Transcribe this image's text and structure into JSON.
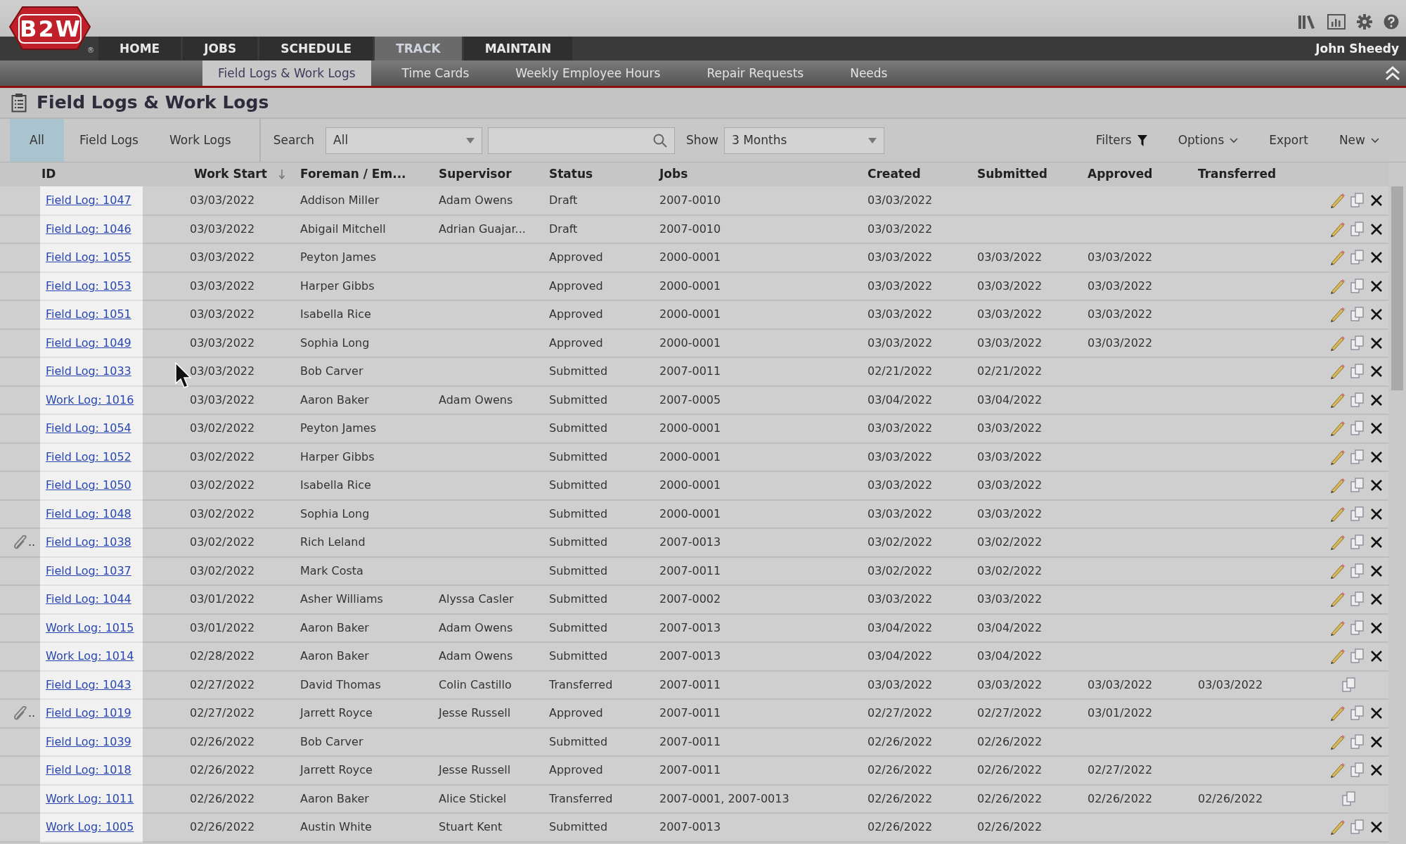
{
  "logo": {
    "text": "B2W",
    "mark": "®"
  },
  "user": "John Sheedy",
  "nav_tabs": [
    {
      "label": "HOME",
      "selected": false
    },
    {
      "label": "JOBS",
      "selected": false
    },
    {
      "label": "SCHEDULE",
      "selected": false
    },
    {
      "label": "TRACK",
      "selected": true
    },
    {
      "label": "MAINTAIN",
      "selected": false
    }
  ],
  "sub_tabs": [
    {
      "label": "Field Logs & Work Logs",
      "selected": true
    },
    {
      "label": "Time Cards",
      "selected": false
    },
    {
      "label": "Weekly Employee Hours",
      "selected": false
    },
    {
      "label": "Repair Requests",
      "selected": false
    },
    {
      "label": "Needs",
      "selected": false
    }
  ],
  "page_title": "Field Logs & Work Logs",
  "filter_tabs": [
    {
      "label": "All",
      "selected": true
    },
    {
      "label": "Field Logs",
      "selected": false
    },
    {
      "label": "Work Logs",
      "selected": false
    }
  ],
  "search": {
    "label": "Search",
    "scope": "All"
  },
  "show": {
    "label": "Show",
    "value": "3 Months"
  },
  "toolbar_actions": [
    {
      "label": "Filters",
      "kind": "filter"
    },
    {
      "label": "Options",
      "kind": "menu"
    },
    {
      "label": "Export",
      "kind": "plain"
    },
    {
      "label": "New",
      "kind": "menu"
    }
  ],
  "table": {
    "columns": [
      {
        "label": "ID",
        "sorted": false
      },
      {
        "label": "Work Start",
        "sorted": true
      },
      {
        "label": "Foreman / Em...",
        "sorted": false
      },
      {
        "label": "Supervisor",
        "sorted": false
      },
      {
        "label": "Status",
        "sorted": false
      },
      {
        "label": "Jobs",
        "sorted": false
      },
      {
        "label": "Created",
        "sorted": false
      },
      {
        "label": "Submitted",
        "sorted": false
      },
      {
        "label": "Approved",
        "sorted": false
      },
      {
        "label": "Transferred",
        "sorted": false
      }
    ],
    "rows": [
      {
        "id": "Field Log: 1047",
        "work_start": "03/03/2022",
        "foreman": "Addison Miller",
        "supervisor": "Adam Owens",
        "status": "Draft",
        "jobs": "2007-0010",
        "created": "03/03/2022",
        "editable": true
      },
      {
        "id": "Field Log: 1046",
        "work_start": "03/03/2022",
        "foreman": "Abigail Mitchell",
        "supervisor": "Adrian Guajar...",
        "status": "Draft",
        "jobs": "2007-0010",
        "created": "03/03/2022",
        "editable": true
      },
      {
        "id": "Field Log: 1055",
        "work_start": "03/03/2022",
        "foreman": "Peyton James",
        "status": "Approved",
        "jobs": "2000-0001",
        "created": "03/03/2022",
        "submitted": "03/03/2022",
        "approved": "03/03/2022",
        "editable": true
      },
      {
        "id": "Field Log: 1053",
        "work_start": "03/03/2022",
        "foreman": "Harper Gibbs",
        "status": "Approved",
        "jobs": "2000-0001",
        "created": "03/03/2022",
        "submitted": "03/03/2022",
        "approved": "03/03/2022",
        "editable": true
      },
      {
        "id": "Field Log: 1051",
        "work_start": "03/03/2022",
        "foreman": "Isabella Rice",
        "status": "Approved",
        "jobs": "2000-0001",
        "created": "03/03/2022",
        "submitted": "03/03/2022",
        "approved": "03/03/2022",
        "editable": true
      },
      {
        "id": "Field Log: 1049",
        "work_start": "03/03/2022",
        "foreman": "Sophia Long",
        "status": "Approved",
        "jobs": "2000-0001",
        "created": "03/03/2022",
        "submitted": "03/03/2022",
        "approved": "03/03/2022",
        "editable": true
      },
      {
        "id": "Field Log: 1033",
        "work_start": "03/03/2022",
        "foreman": "Bob Carver",
        "status": "Submitted",
        "jobs": "2007-0011",
        "created": "02/21/2022",
        "submitted": "02/21/2022",
        "editable": true
      },
      {
        "id": "Work Log: 1016",
        "work_start": "03/03/2022",
        "foreman": "Aaron Baker",
        "supervisor": "Adam Owens",
        "status": "Submitted",
        "jobs": "2007-0005",
        "created": "03/04/2022",
        "submitted": "03/04/2022",
        "editable": true
      },
      {
        "id": "Field Log: 1054",
        "work_start": "03/02/2022",
        "foreman": "Peyton James",
        "status": "Submitted",
        "jobs": "2000-0001",
        "created": "03/03/2022",
        "submitted": "03/03/2022",
        "editable": true
      },
      {
        "id": "Field Log: 1052",
        "work_start": "03/02/2022",
        "foreman": "Harper Gibbs",
        "status": "Submitted",
        "jobs": "2000-0001",
        "created": "03/03/2022",
        "submitted": "03/03/2022",
        "editable": true
      },
      {
        "id": "Field Log: 1050",
        "work_start": "03/02/2022",
        "foreman": "Isabella Rice",
        "status": "Submitted",
        "jobs": "2000-0001",
        "created": "03/03/2022",
        "submitted": "03/03/2022",
        "editable": true
      },
      {
        "id": "Field Log: 1048",
        "work_start": "03/02/2022",
        "foreman": "Sophia Long",
        "status": "Submitted",
        "jobs": "2000-0001",
        "created": "03/03/2022",
        "submitted": "03/03/2022",
        "editable": true
      },
      {
        "attachment": "..",
        "id": "Field Log: 1038",
        "work_start": "03/02/2022",
        "foreman": "Rich Leland",
        "status": "Submitted",
        "jobs": "2007-0013",
        "created": "03/02/2022",
        "submitted": "03/02/2022",
        "editable": true
      },
      {
        "id": "Field Log: 1037",
        "work_start": "03/02/2022",
        "foreman": "Mark Costa",
        "status": "Submitted",
        "jobs": "2007-0011",
        "created": "03/02/2022",
        "submitted": "03/02/2022",
        "editable": true
      },
      {
        "id": "Field Log: 1044",
        "work_start": "03/01/2022",
        "foreman": "Asher Williams",
        "supervisor": "Alyssa Casler",
        "status": "Submitted",
        "jobs": "2007-0002",
        "created": "03/03/2022",
        "submitted": "03/03/2022",
        "editable": true
      },
      {
        "id": "Work Log: 1015",
        "work_start": "03/01/2022",
        "foreman": "Aaron Baker",
        "supervisor": "Adam Owens",
        "status": "Submitted",
        "jobs": "2007-0013",
        "created": "03/04/2022",
        "submitted": "03/04/2022",
        "editable": true
      },
      {
        "id": "Work Log: 1014",
        "work_start": "02/28/2022",
        "foreman": "Aaron Baker",
        "supervisor": "Adam Owens",
        "status": "Submitted",
        "jobs": "2007-0013",
        "created": "03/04/2022",
        "submitted": "03/04/2022",
        "editable": true
      },
      {
        "id": "Field Log: 1043",
        "work_start": "02/27/2022",
        "foreman": "David Thomas",
        "supervisor": "Colin Castillo",
        "status": "Transferred",
        "jobs": "2007-0011",
        "created": "03/03/2022",
        "submitted": "03/03/2022",
        "approved": "03/03/2022",
        "transferred": "03/03/2022",
        "editable": false
      },
      {
        "attachment": "..",
        "id": "Field Log: 1019",
        "work_start": "02/27/2022",
        "foreman": "Jarrett Royce",
        "supervisor": "Jesse Russell",
        "status": "Approved",
        "jobs": "2007-0011",
        "created": "02/27/2022",
        "submitted": "02/27/2022",
        "approved": "03/01/2022",
        "editable": true
      },
      {
        "id": "Field Log: 1039",
        "work_start": "02/26/2022",
        "foreman": "Bob Carver",
        "status": "Submitted",
        "jobs": "2007-0011",
        "created": "02/26/2022",
        "submitted": "02/26/2022",
        "editable": true
      },
      {
        "id": "Field Log: 1018",
        "work_start": "02/26/2022",
        "foreman": "Jarrett Royce",
        "supervisor": "Jesse Russell",
        "status": "Approved",
        "jobs": "2007-0011",
        "created": "02/26/2022",
        "submitted": "02/26/2022",
        "approved": "02/27/2022",
        "editable": true
      },
      {
        "id": "Work Log: 1011",
        "work_start": "02/26/2022",
        "foreman": "Aaron Baker",
        "supervisor": "Alice Stickel",
        "status": "Transferred",
        "jobs": "2007-0001, 2007-0013",
        "created": "02/26/2022",
        "submitted": "02/26/2022",
        "approved": "02/26/2022",
        "transferred": "02/26/2022",
        "editable": false
      },
      {
        "id": "Work Log: 1005",
        "work_start": "02/26/2022",
        "foreman": "Austin White",
        "supervisor": "Stuart Kent",
        "status": "Submitted",
        "jobs": "2007-0013",
        "created": "02/26/2022",
        "submitted": "02/26/2022",
        "editable": true
      }
    ]
  }
}
